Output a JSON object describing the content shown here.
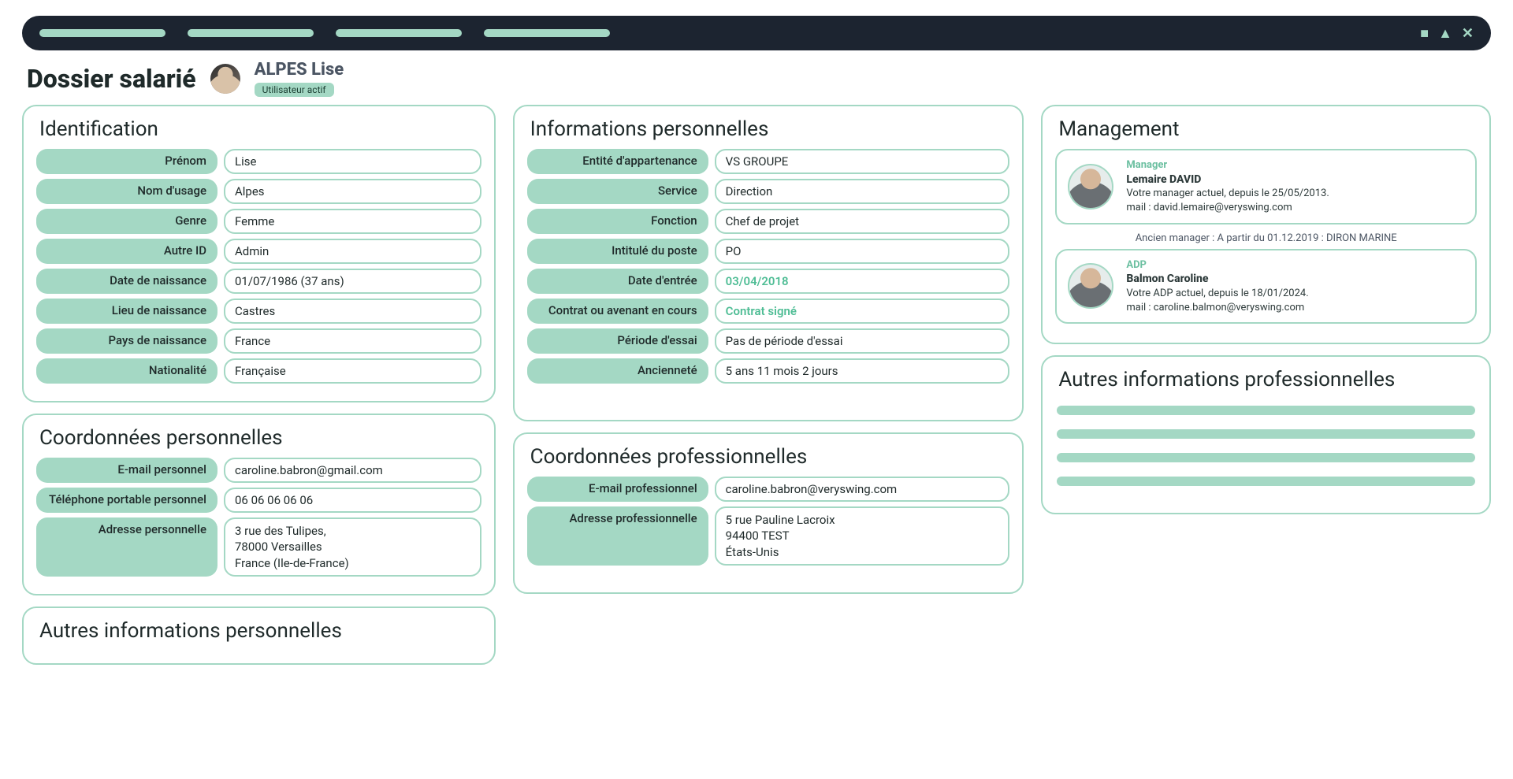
{
  "page_title": "Dossier salarié",
  "user": {
    "name": "ALPES Lise",
    "badge": "Utilisateur actif"
  },
  "identification": {
    "title": "Identification",
    "rows": [
      {
        "label": "Prénom",
        "value": "Lise"
      },
      {
        "label": "Nom d'usage",
        "value": "Alpes"
      },
      {
        "label": "Genre",
        "value": "Femme"
      },
      {
        "label": "Autre ID",
        "value": "Admin"
      },
      {
        "label": "Date de naissance",
        "value": "01/07/1986 (37 ans)"
      },
      {
        "label": "Lieu de naissance",
        "value": "Castres"
      },
      {
        "label": "Pays de naissance",
        "value": "France"
      },
      {
        "label": "Nationalité",
        "value": "Française"
      }
    ]
  },
  "coord_perso": {
    "title": "Coordonnées personnelles",
    "rows": [
      {
        "label": "E-mail personnel",
        "value": "caroline.babron@gmail.com"
      },
      {
        "label": "Téléphone portable personnel",
        "value": "06 06 06 06 06"
      },
      {
        "label": "Adresse personnelle",
        "value": "3 rue des Tulipes,\n78000 Versailles\nFrance (Ile-de-France)",
        "multi": true
      }
    ]
  },
  "autres_perso": {
    "title": "Autres informations personnelles"
  },
  "info_pro": {
    "title": "Informations personnelles",
    "rows": [
      {
        "label": "Entité d'appartenance",
        "value": "VS GROUPE"
      },
      {
        "label": "Service",
        "value": "Direction"
      },
      {
        "label": "Fonction",
        "value": "Chef de projet"
      },
      {
        "label": "Intitulé du poste",
        "value": "PO"
      },
      {
        "label": "Date d'entrée",
        "value": "03/04/2018",
        "highlight": true
      },
      {
        "label": "Contrat ou avenant en cours",
        "value": "Contrat signé",
        "highlight": true
      },
      {
        "label": "Période d'essai",
        "value": "Pas de période d'essai"
      },
      {
        "label": "Ancienneté",
        "value": "5 ans 11 mois 2 jours"
      }
    ]
  },
  "coord_pro": {
    "title": "Coordonnées professionnelles",
    "rows": [
      {
        "label": "E-mail professionnel",
        "value": "caroline.babron@veryswing.com"
      },
      {
        "label": "Adresse professionnelle",
        "value": "5 rue Pauline Lacroix\n94400 TEST\nÉtats-Unis",
        "multi": true
      }
    ]
  },
  "management": {
    "title": "Management",
    "manager": {
      "role": "Manager",
      "name": "Lemaire DAVID",
      "line1": "Votre manager actuel, depuis le 25/05/2013.",
      "line2": "mail : david.lemaire@veryswing.com"
    },
    "note": "Ancien manager : A partir du 01.12.2019 : DIRON MARINE",
    "adp": {
      "role": "ADP",
      "name": "Balmon Caroline",
      "line1": "Votre ADP actuel, depuis le 18/01/2024.",
      "line2": "mail : caroline.balmon@veryswing.com"
    }
  },
  "autres_pro": {
    "title": "Autres informations professionnelles"
  }
}
